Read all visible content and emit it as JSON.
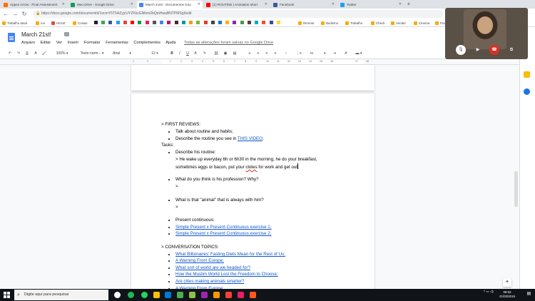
{
  "browser": {
    "tabs": [
      {
        "label": "Appen Arrow - Final Assessment",
        "active": false,
        "color": "#ff6d01"
      },
      {
        "label": "Meu Drive - Google Drive",
        "active": false,
        "color": "#0f9d58"
      },
      {
        "label": "March 21st! - Documentos Goo",
        "active": true,
        "color": "#4285f4"
      },
      {
        "label": "(1) ROUTINE | Animation short",
        "active": false,
        "color": "#ff0000"
      },
      {
        "label": "Facebook",
        "active": false,
        "color": "#3b5998"
      },
      {
        "label": "Twitter",
        "active": false,
        "color": "#1da1f2"
      }
    ],
    "url": "https://docs.google.com/document/d/1ocmY5T5AZyjcUYZKkzGNfvm2bQmHwaBNTPMSgI/edit",
    "bookmarks": [
      "Trabalho atual",
      "Ler",
      "HOUZ",
      "Coisas",
      "Remoto",
      "Budismo",
      "Trabalho",
      "Check",
      "Vender",
      "Cinema",
      "Fran"
    ]
  },
  "docs": {
    "title": "March 21st!",
    "menus": [
      "Arquivo",
      "Editar",
      "Ver",
      "Inserir",
      "Formatar",
      "Ferramentas",
      "Complementos",
      "Ajuda"
    ],
    "saved_status": "Todas as alterações foram salvas no Google Drive",
    "toolbar": {
      "zoom": "100%",
      "style": "Texto norm...",
      "font": "Arial",
      "size": "12"
    },
    "ruler_numbers": [
      "1",
      "2",
      "1",
      "2",
      "3",
      "4",
      "5",
      "6",
      "7",
      "8",
      "9",
      "10",
      "11",
      "12",
      "13",
      "14",
      "15",
      "16",
      "17",
      "18"
    ]
  },
  "content": {
    "first_reviews": "> FIRST REVIEWS:",
    "fr_items": [
      "Talk about routine and habits;"
    ],
    "fr_video_pre": "Describe the routine you see in ",
    "fr_video_link": "THIS VIDEO",
    "fr_video_post": ";",
    "tasks": "Tasks:",
    "t1": "Describe his routine:",
    "t1_answer1": "> He wake up everyday 6h or 6h30 in the morning, he do your breakfast,",
    "t1_answer2_pre": "sometimes eggs or bacon, put your ",
    "t1_answer2_spell": "clotes",
    "t1_answer2_post": " for work and get out",
    "t2": "What do you think is his profession? Why?",
    "t2_answer": ">",
    "t3": "What is that \"animal\" that is always with him?",
    "t3_answer": ">",
    "t4": "Present continuous:",
    "t4_links": [
      "Simple Present x Present Continuous exercise 1;",
      "Simple Present x Present Continuous exercise 2;"
    ],
    "conversation": "> CONVERSATION TOPICS:",
    "conv_links": [
      "What Billionaires' Fasting Diets Mean for the Rest of Us;",
      "A Warning From Europe;",
      "What sort of world are we headed for?",
      "How the Muslim World Lost the Freedom to Choose;",
      "Are cities making animals smarter?",
      "A Warning From Europe;"
    ]
  },
  "taskbar": {
    "search_placeholder": "Digite aqui para pesquisar",
    "time": "08:53",
    "date": "21/03/2019"
  }
}
